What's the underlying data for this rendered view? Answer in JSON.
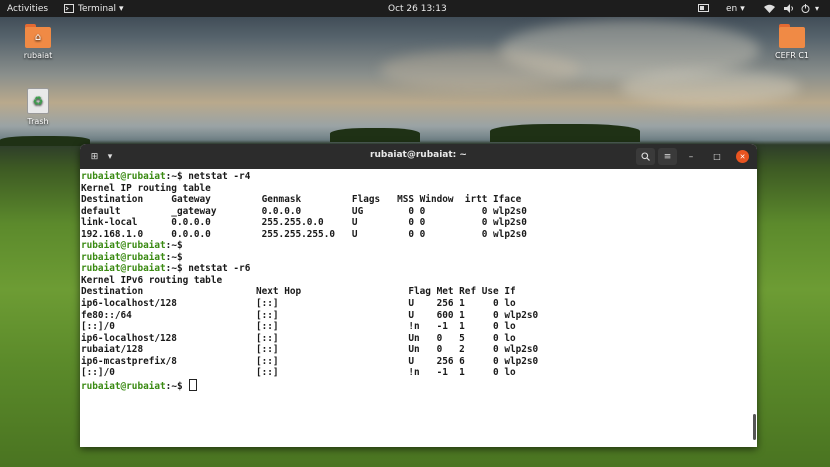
{
  "topbar": {
    "activities": "Activities",
    "app_name": "Terminal",
    "app_menu_arrow": "▾",
    "datetime": "Oct 26  13:13",
    "lang": "en",
    "lang_arrow": "▾"
  },
  "desktop": {
    "icons": [
      {
        "label": "rubaiat",
        "icon": "home-folder-icon"
      },
      {
        "label": "Trash",
        "icon": "trash-icon"
      },
      {
        "label": "CEFR C1",
        "icon": "folder-icon"
      }
    ]
  },
  "window": {
    "title": "rubaiat@rubaiat: ~",
    "new_tab_icon": "⊞",
    "menu_arrow": "▾",
    "search_icon": "⌕",
    "hamburger_icon": "≡",
    "minimize_icon": "–",
    "maximize_icon": "□",
    "close_icon": "✕"
  },
  "terminal": {
    "lines": [
      {
        "prompt": "rubaiat@rubaiat",
        "suffix": ":~$ netstat -r4"
      },
      {
        "text": "Kernel IP routing table"
      },
      {
        "text": "Destination     Gateway         Genmask         Flags   MSS Window  irtt Iface"
      },
      {
        "text": "default         _gateway        0.0.0.0         UG        0 0          0 wlp2s0"
      },
      {
        "text": "link-local      0.0.0.0         255.255.0.0     U         0 0          0 wlp2s0"
      },
      {
        "text": "192.168.1.0     0.0.0.0         255.255.255.0   U         0 0          0 wlp2s0"
      },
      {
        "prompt": "rubaiat@rubaiat",
        "suffix": ":~$"
      },
      {
        "prompt": "rubaiat@rubaiat",
        "suffix": ":~$"
      },
      {
        "prompt": "rubaiat@rubaiat",
        "suffix": ":~$ netstat -r6"
      },
      {
        "text": "Kernel IPv6 routing table"
      },
      {
        "text": "Destination                    Next Hop                   Flag Met Ref Use If"
      },
      {
        "text": "ip6-localhost/128              [::]                       U    256 1     0 lo"
      },
      {
        "text": "fe80::/64                      [::]                       U    600 1     0 wlp2s0"
      },
      {
        "text": "[::]/0                         [::]                       !n   -1  1     0 lo"
      },
      {
        "text": "ip6-localhost/128              [::]                       Un   0   5     0 lo"
      },
      {
        "text": "rubaiat/128                    [::]                       Un   0   2     0 wlp2s0"
      },
      {
        "text": "ip6-mcastprefix/8              [::]                       U    256 6     0 wlp2s0"
      },
      {
        "text": "[::]/0                         [::]                       !n   -1  1     0 lo"
      },
      {
        "prompt": "rubaiat@rubaiat",
        "suffix": ":~$ ",
        "cursor": true
      }
    ]
  },
  "colors": {
    "prompt": "#3a8a12",
    "titlebar": "#2c2c2c",
    "close_button": "#e95420",
    "topbar": "#1d1d1d"
  }
}
